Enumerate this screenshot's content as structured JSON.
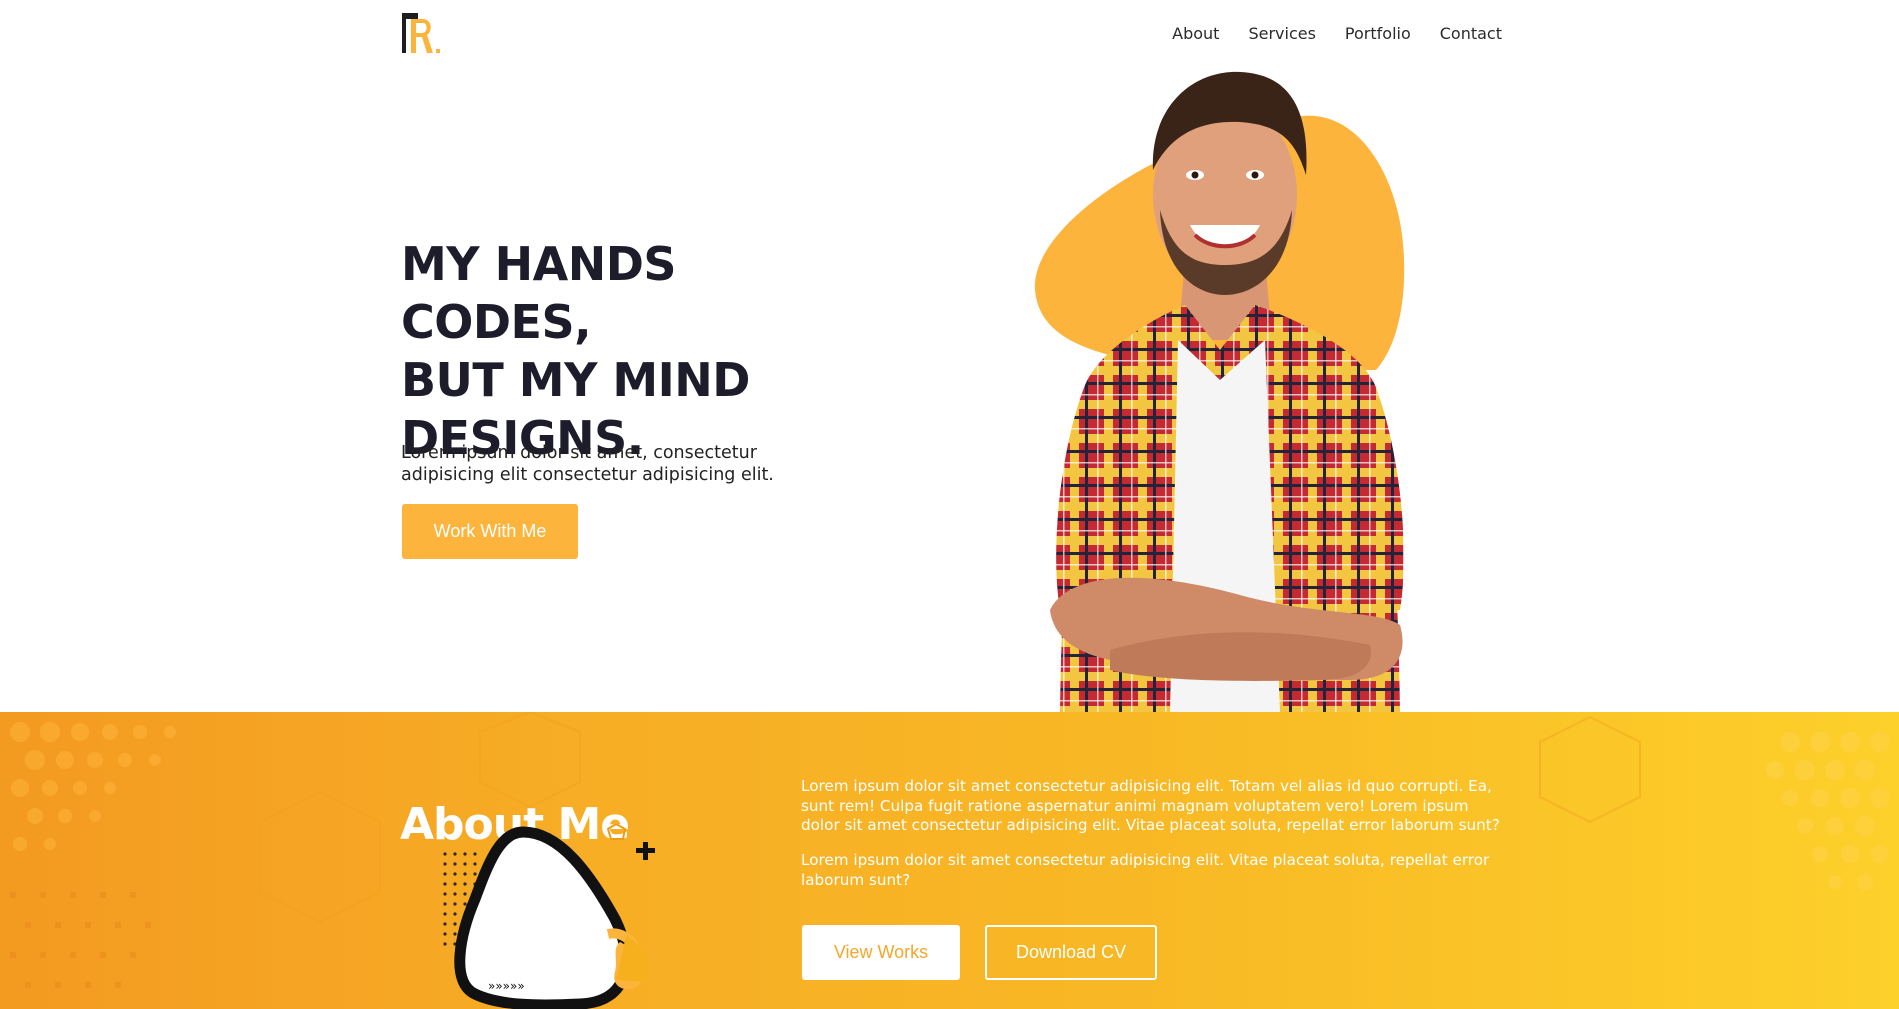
{
  "nav": {
    "logo": "logo",
    "items": [
      "About",
      "Services",
      "Portfolio",
      "Contact"
    ]
  },
  "hero": {
    "title": "MY HANDS CODES,\nBUT MY MIND\nDESIGNS.",
    "description": "Lorem ipsum dolor sit amet, consectetur adipisicing elit consectetur adipisicing elit.",
    "cta_label": "Work With Me"
  },
  "about": {
    "title": "About Me",
    "paragraphs": [
      "Lorem ipsum dolor sit amet consectetur adipisicing elit. Totam vel alias id quo corrupti. Ea, sunt rem! Culpa fugit ratione aspernatur animi magnam voluptatem vero! Lorem ipsum dolor sit amet consectetur adipisicing elit. Vitae placeat soluta, repellat error laborum sunt?",
      "Lorem ipsum dolor sit amet consectetur adipisicing elit. Vitae placeat soluta, repellat error laborum sunt?"
    ],
    "view_works_label": "View Works",
    "download_cv_label": "Download CV",
    "arrows": "»»»»»"
  },
  "colors": {
    "accent": "#fdb43c",
    "dark_text": "#1c1c2a",
    "band_start": "#f39a21",
    "band_end": "#fdd02a"
  }
}
